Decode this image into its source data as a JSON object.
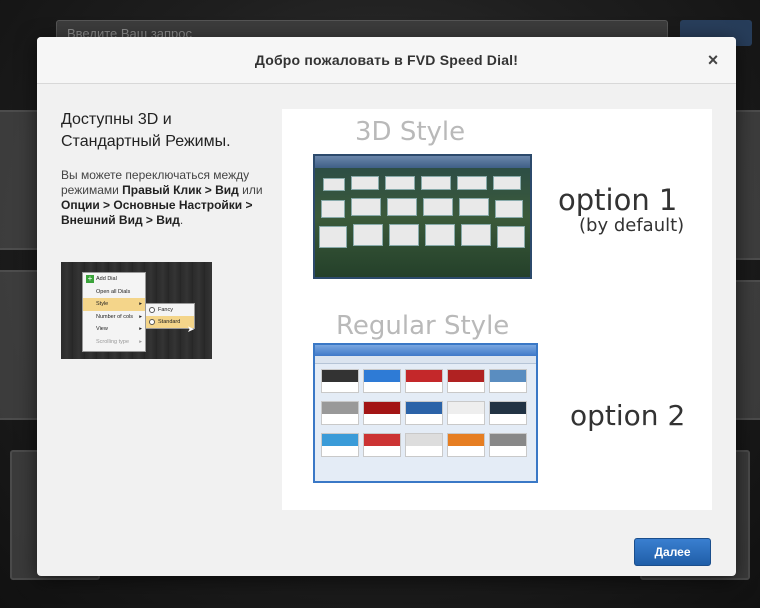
{
  "background": {
    "search_placeholder": "Введите Ваш запрос"
  },
  "modal": {
    "title": "Добро пожаловать в FVD Speed Dial!",
    "close_label": "×",
    "heading": "Доступны 3D и Стандартный Режимы.",
    "description": {
      "part1": "Вы можете переключаться между режимами ",
      "bold1": "Правый Клик > Вид",
      "part2": " или ",
      "bold2": "Опции > Основные Настройки > Внешний Вид > Вид",
      "part3": "."
    },
    "context_menu": {
      "items": [
        "Add Dial",
        "Open all Dials",
        "Style",
        "Number of cols",
        "View",
        "Scrolling type"
      ],
      "submenu": [
        "Fancy",
        "Standard"
      ]
    },
    "style_3d_label": "3D Style",
    "option1_label": "option 1",
    "option1_note": "(by default)",
    "style_regular_label": "Regular Style",
    "option2_label": "option 2",
    "next_button": "Далее"
  },
  "colors": {
    "accent": "#2a6bbd",
    "modal_bg": "#f1f1f1",
    "highlight": "#f4d58a"
  }
}
